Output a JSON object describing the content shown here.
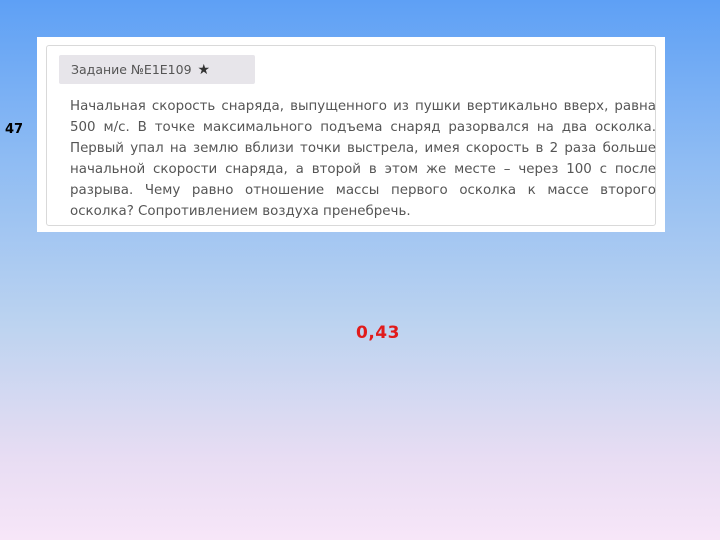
{
  "slide": {
    "number": "47"
  },
  "task": {
    "header": "Задание №E1E109",
    "star_icon": "star-icon",
    "text": "Начальная скорость снаряда, выпущенного из пушки вертикально вверх, равна 500 м/с. В точке максимального подъема снаряд разорвался на два осколка. Первый упал на землю вблизи точки выстрела, имея скорость в 2 раза больше начальной скорости снаряда, а второй в этом же месте – через 100 с после разрыва. Чему равно отношение массы первого осколка к массе второго осколка? Сопротивлением воздуха пренебречь."
  },
  "answer": {
    "value": "0,43",
    "color": "#e11b1b"
  }
}
